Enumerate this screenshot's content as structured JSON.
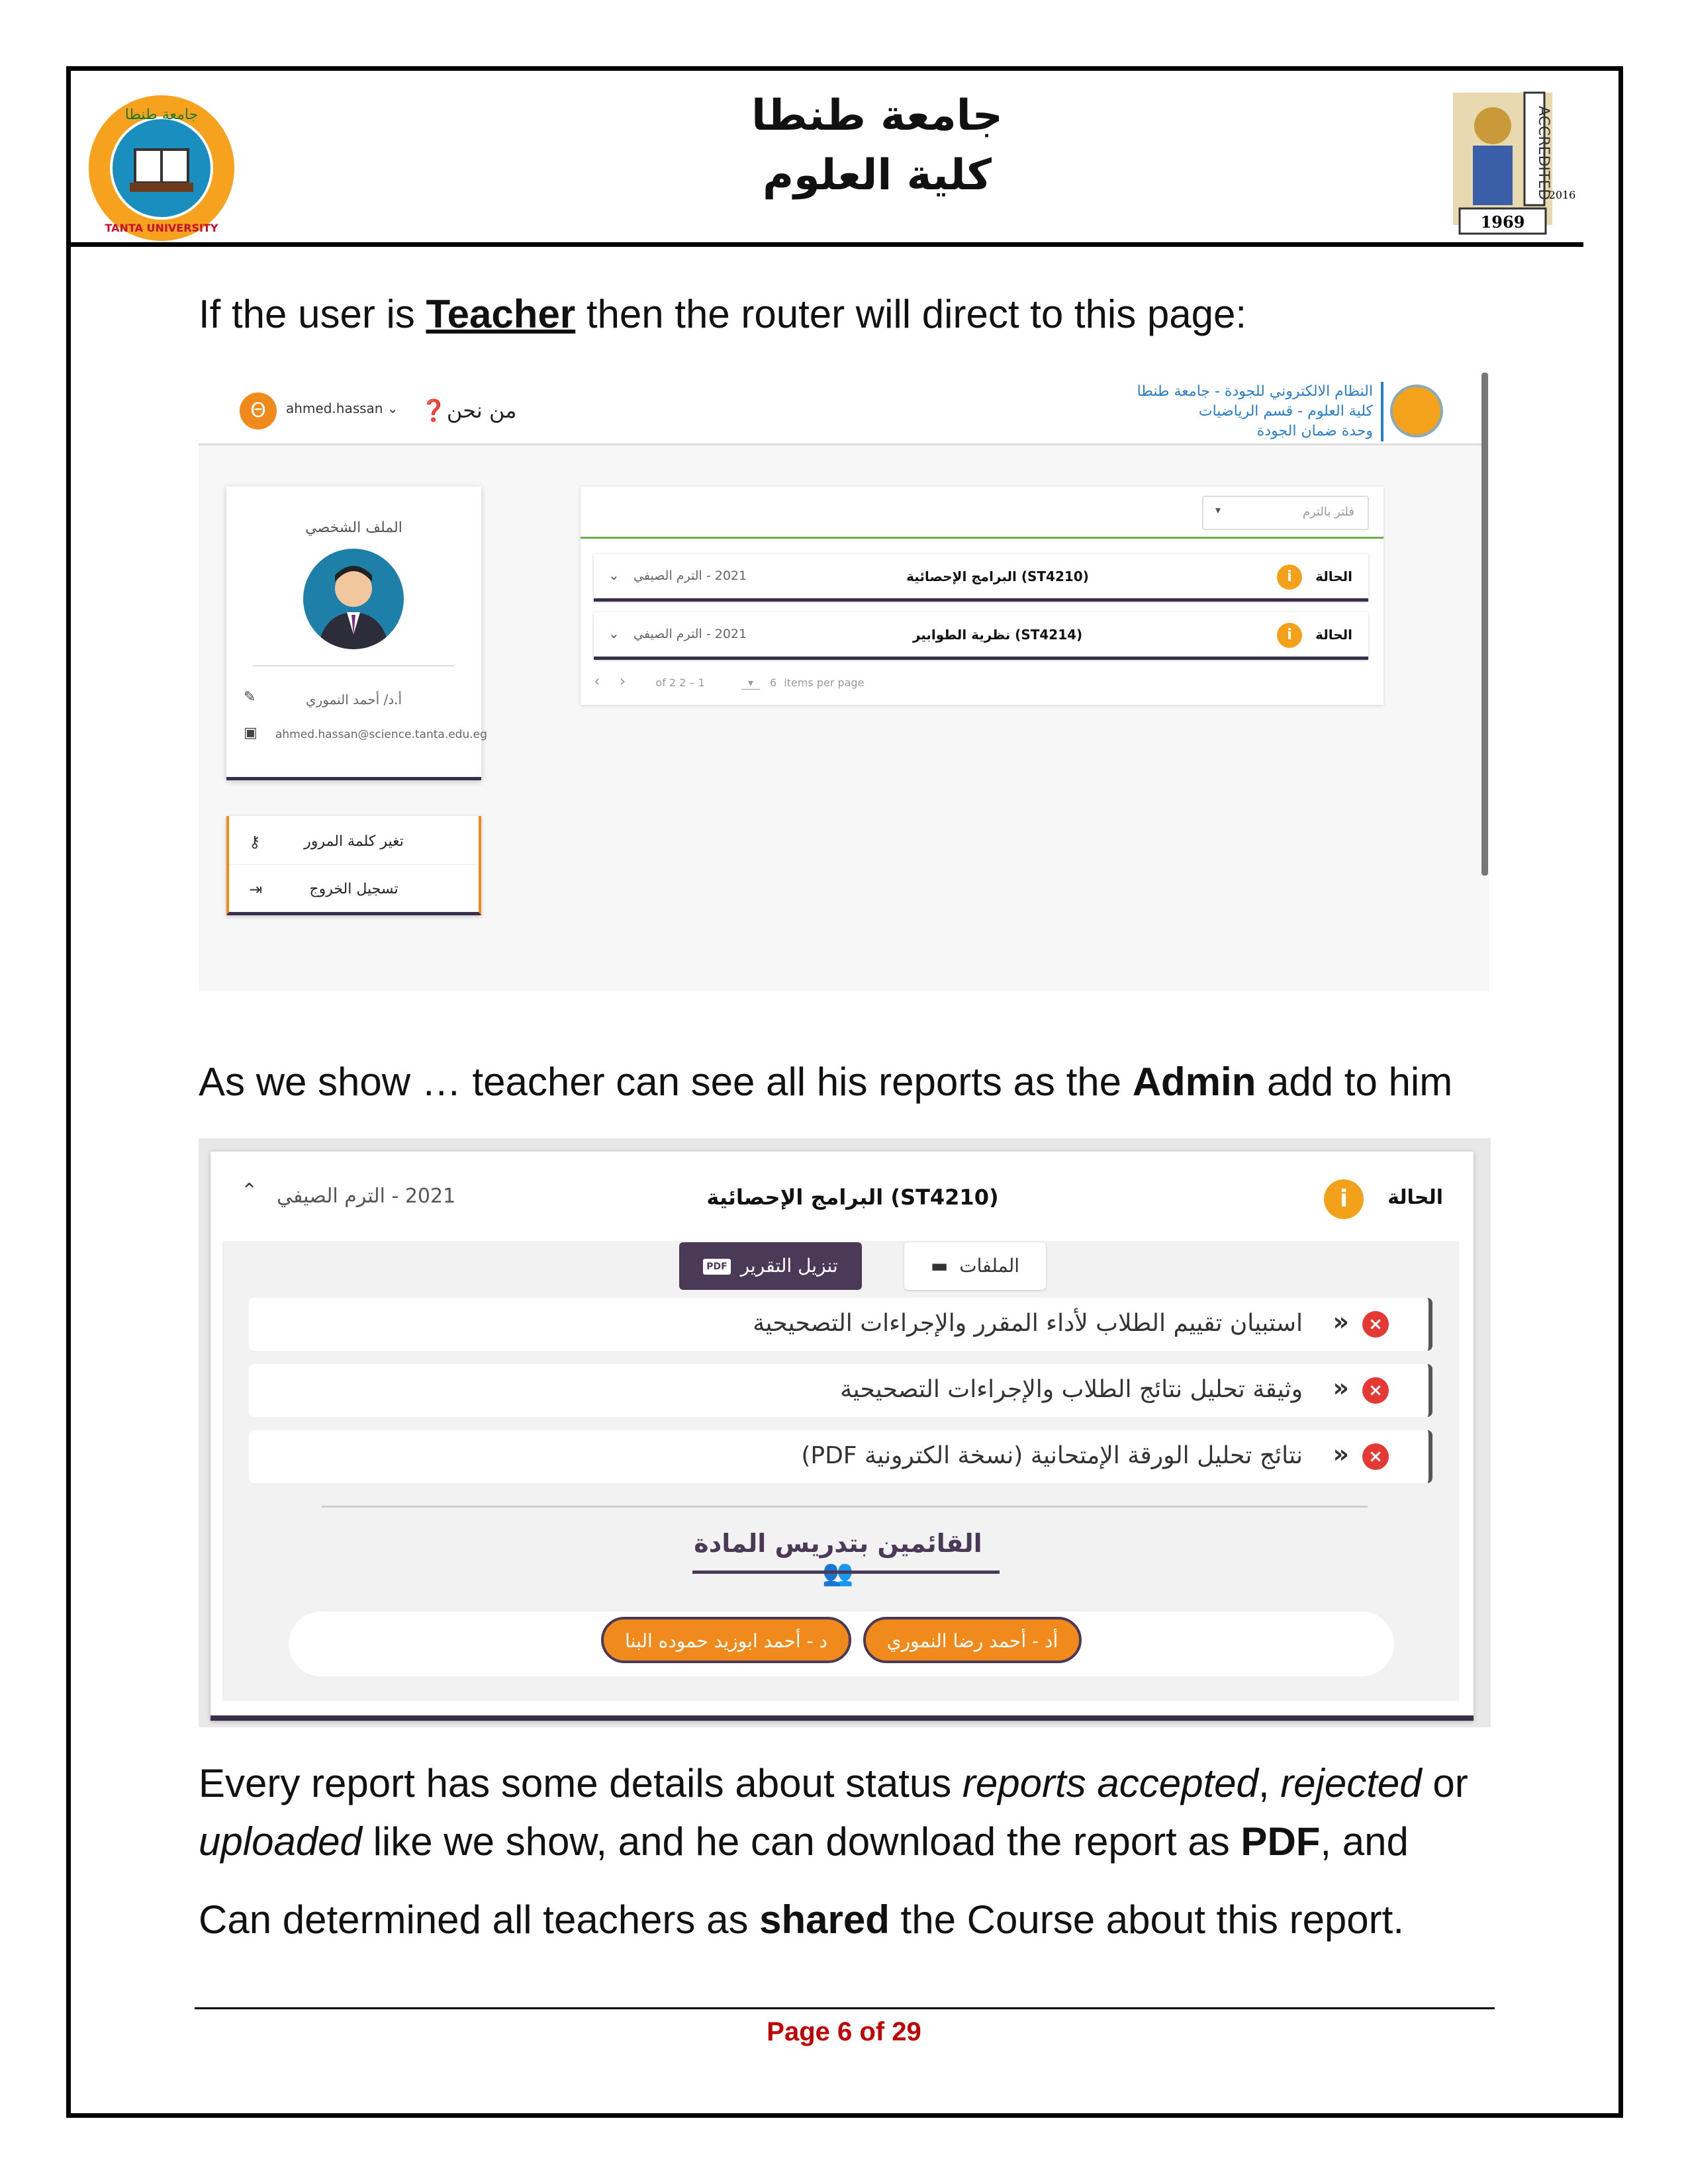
{
  "header": {
    "university": "جامعة طنطا",
    "faculty": "كلية العلوم",
    "left_logo_text": "TANTA UNIVERSITY",
    "right_logo_text": "ACCREDITED",
    "right_logo_year": "1969",
    "right_logo_year2": "2016"
  },
  "intro": {
    "before": "If the user is ",
    "role": "Teacher",
    "after": " then the router will direct to this page:"
  },
  "shot1": {
    "user_initial": "Θ",
    "user_name": "ahmed.hassan",
    "who_link": "من نحن",
    "system_name": [
      "النظام الالكتروني للجودة - جامعة طنطا",
      "كلية العلوم - قسم الرياضيات",
      "وحدة ضمان الجودة"
    ],
    "profile_title": "الملف الشخصي",
    "profile_name": "أ.د/ أحمد النموري",
    "profile_email": "ahmed.hassan@science.tanta.edu.eg",
    "menu": [
      "تغير كلمة المرور",
      "تسجيل الخروج"
    ],
    "filter_placeholder": "فلتر بالترم",
    "rows": [
      {
        "status": "الحالة",
        "title": "(ST4210) البرامج الإحصائية",
        "term": "2021 - الترم الصيفي"
      },
      {
        "status": "الحالة",
        "title": "(ST4214) نظرية الطوابير",
        "term": "2021 - الترم الصيفي"
      }
    ],
    "pager_range": "of 2 2 – 1",
    "pager_size": "6",
    "pager_label": "items per page"
  },
  "middle": {
    "before": "As we show … teacher can see all his reports as the ",
    "admin": "Admin",
    "after": " add to him"
  },
  "shot2": {
    "status": "الحالة",
    "badge": "i",
    "title": "(ST4210) البرامج الإحصائية",
    "term": "2021 - الترم الصيفي",
    "download_label": "تنزيل التقرير",
    "files_label": "الملفات",
    "documents": [
      "استبيان تقييم الطلاب لأداء المقرر والإجراءات التصحيحية",
      "وثيقة تحليل نتائج الطلاب والإجراءات التصحيحية",
      "نتائج تحليل الورقة الإمتحانية (نسخة الكترونية PDF)"
    ],
    "teachers_title": "القائمين بتدريس المادة",
    "teachers": [
      "أد - أحمد رضا النموري",
      "د - أحمد ابوزيد حموده البنا"
    ]
  },
  "closing": {
    "l1_a": "Every report has some details about status ",
    "l1_b": "reports accepted",
    "l1_c": ", ",
    "l1_d": "rejected",
    "l1_e": " or",
    "l2_a": "uploaded",
    "l2_b": " like we show, and he can download the report as ",
    "l2_c": "PDF",
    "l2_d": ", and",
    "l3_a": "Can determined all teachers as ",
    "l3_b": "shared",
    "l3_c": " the Course about this report."
  },
  "footer": {
    "page": "Page 6 of 29"
  },
  "colors": {
    "accent_orange": "#f08a1c",
    "dark_purple": "#4a3a58",
    "error_red": "#e53935",
    "page_red": "#c00000"
  }
}
